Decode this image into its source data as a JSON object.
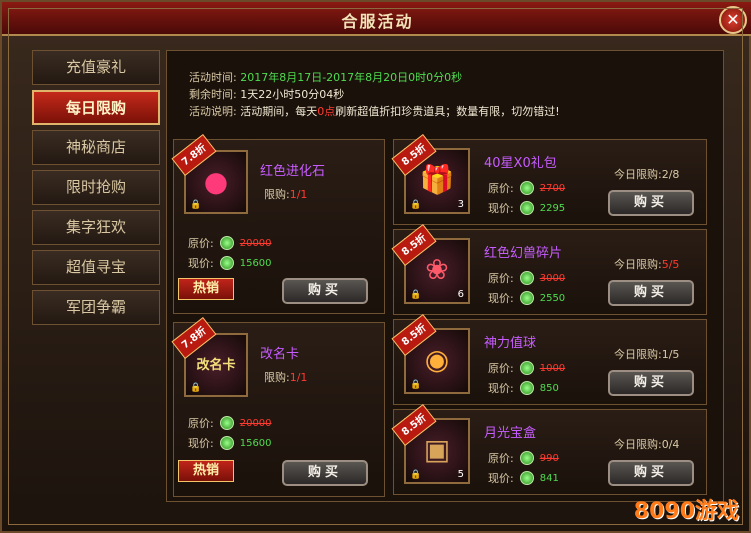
{
  "window": {
    "title": "合服活动",
    "close_label": "✕"
  },
  "sidebar": {
    "items": [
      {
        "label": "充值豪礼",
        "active": false
      },
      {
        "label": "每日限购",
        "active": true
      },
      {
        "label": "神秘商店",
        "active": false
      },
      {
        "label": "限时抢购",
        "active": false
      },
      {
        "label": "集字狂欢",
        "active": false
      },
      {
        "label": "超值寻宝",
        "active": false
      },
      {
        "label": "军团争霸",
        "active": false
      }
    ]
  },
  "info": {
    "time_label": "活动时间:",
    "time_value": "2017年8月17日-2017年8月20日0时0分0秒",
    "remain_label": "剩余时间:",
    "remain_value": "1天22小时50分04秒",
    "desc_label": "活动说明:",
    "desc_prefix": "活动期间，每天",
    "desc_highlight": "0点",
    "desc_suffix": "刷新超值折扣珍贵道具；数量有限，切勿错过!"
  },
  "labels": {
    "orig_price": "原价:",
    "now_price": "现价:",
    "limit": "限购:",
    "today_limit": "今日限购:",
    "buy": "购买",
    "hot": "热销"
  },
  "left_items": [
    {
      "discount": "7.8折",
      "name": "红色进化石",
      "limit": "1/1",
      "orig": "20000",
      "now": "15600",
      "hot": true,
      "icon": "red-orb-icon"
    },
    {
      "discount": "7.8折",
      "name": "改名卡",
      "limit": "1/1",
      "orig": "20000",
      "now": "15600",
      "hot": true,
      "icon": "rename-card-icon",
      "card_text": "改名卡"
    }
  ],
  "right_items": [
    {
      "discount": "8.5折",
      "name": "40星X0礼包",
      "count": "3",
      "orig": "2700",
      "now": "2295",
      "today": "2/8",
      "today_full": false
    },
    {
      "discount": "8.5折",
      "name": "红色幻兽碎片",
      "count": "6",
      "orig": "3000",
      "now": "2550",
      "today": "5/5",
      "today_full": true
    },
    {
      "discount": "8.5折",
      "name": "神力值球",
      "count": "",
      "orig": "1000",
      "now": "850",
      "today": "1/5",
      "today_full": false
    },
    {
      "discount": "8.5折",
      "name": "月光宝盒",
      "count": "5",
      "orig": "990",
      "now": "841",
      "today": "0/4",
      "today_full": false
    }
  ],
  "watermark": {
    "text": "8090游戏"
  },
  "colors": {
    "accent_red": "#c4291a",
    "green_price": "#4fdc4f",
    "purple_name": "#c75cff",
    "strike_red": "#ff3a30"
  }
}
